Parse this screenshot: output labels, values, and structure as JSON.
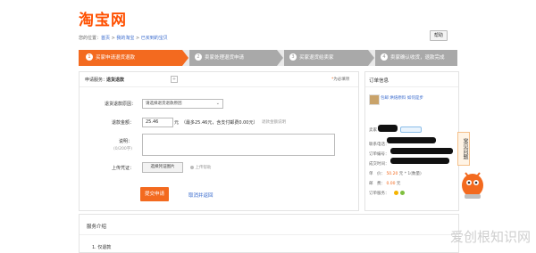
{
  "header": {
    "logo": "淘宝网",
    "help_button": "帮助"
  },
  "breadcrumb": {
    "prefix": "您的位置：",
    "items": [
      "首页",
      "我的淘宝",
      "已买到的宝贝"
    ],
    "separator": " > "
  },
  "steps": [
    {
      "num": "1",
      "label": "买家申请退货退款"
    },
    {
      "num": "2",
      "label": "卖家处理退货申请"
    },
    {
      "num": "3",
      "label": "买家退货给卖家"
    },
    {
      "num": "4",
      "label": "卖家确认收货，退款完成"
    }
  ],
  "form": {
    "service_label": "申请服务：",
    "service_value": "退货退款",
    "refund_reason_label": "退货退款原因：",
    "refund_reason_value": "请选择退货退款原因",
    "amount_label": "退款金额：",
    "amount_value": "25.46",
    "amount_unit": "元",
    "amount_max_note": "（最多25.46元，含支付邮费0.00元）",
    "amount_suffix": "退款金额说明",
    "desc_label": "说明：",
    "desc_counter": "(0/200字)",
    "upload_label": "上传凭证：",
    "upload_button": "选择凭证图片",
    "upload_help": "上传帮助",
    "submit_button": "提交申请",
    "cancel_link": "取消并返回",
    "help_link": "为必填项"
  },
  "order": {
    "title": "订单信息",
    "product_name": "包邮 烘焙原料 如何是步",
    "seller_label": "卖",
    "seller_badge": "家",
    "order_no_label": "联系电话：",
    "order_id_label": "订单编号：",
    "time_label": "成交时间：",
    "price_label": "单　价：",
    "price_value": "50.20",
    "qty_value": "元 * 1(数量)",
    "postage_label": "邮　费：",
    "postage_value": "0.00",
    "postage_unit": "元",
    "service_label": "订单服务："
  },
  "service": {
    "title": "服务介绍",
    "first_item": "1. 仅退款"
  },
  "side_tab": "常见问题",
  "watermark": "爱创根知识网",
  "colors": {
    "accent": "#f36a1f",
    "link": "#3366cc"
  }
}
